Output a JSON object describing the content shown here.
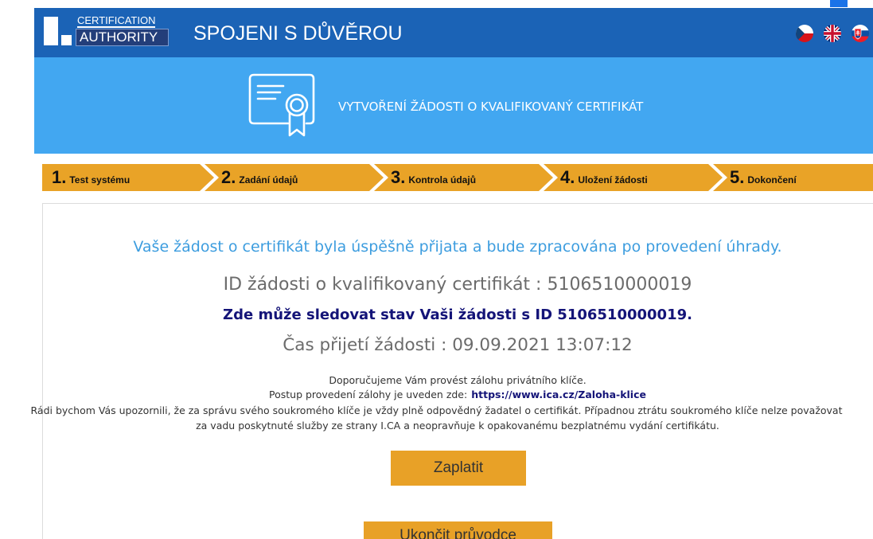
{
  "colors": {
    "header_bg": "#1b63b6",
    "banner_bg": "#42a7f1",
    "steps_bg": "#e9a327",
    "success_text": "#3d9ddf",
    "muted_text": "#666666",
    "link_text": "#141478",
    "button_bg": "#e8a127"
  },
  "header": {
    "logo": {
      "mark": "I.",
      "line1": "CERTIFICATION",
      "line2": "AUTHORITY"
    },
    "tagline": "SPOJENI S DŮVĚROU",
    "languages": [
      {
        "icon": "flag-cz-icon"
      },
      {
        "icon": "flag-gb-icon"
      },
      {
        "icon": "flag-sk-icon"
      }
    ]
  },
  "banner": {
    "icon": "certificate-icon",
    "title": "VYTVOŘENÍ ŽÁDOSTI O KVALIFIKOVANÝ CERTIFIKÁT"
  },
  "steps": [
    {
      "number": "1.",
      "label": "Test systému"
    },
    {
      "number": "2.",
      "label": "Zadání údajů"
    },
    {
      "number": "3.",
      "label": "Kontrola údajů"
    },
    {
      "number": "4.",
      "label": "Uložení žádosti"
    },
    {
      "number": "5.",
      "label": "Dokončení"
    }
  ],
  "result": {
    "success_message": "Vaše žádost o certifikát byla úspěšně přijata a bude zpracována po provedení úhrady.",
    "request_id_line": "ID žádosti o kvalifikovaný certifikát : 5106510000019",
    "tracking_link": "Zde může sledovat stav Vaši žádosti s ID 5106510000019.",
    "received_time_line": "Čas přijetí žádosti : 09.09.2021 13:07:12"
  },
  "backup": {
    "recommendation": "Doporučujeme Vám provést zálohu privátního klíče.",
    "instructions_prefix": "Postup provedení zálohy je uveden zde:",
    "instructions_link": "https://www.ica.cz/Zaloha-klice",
    "notice_lines": [
      "Rádi bychom Vás upozornili, že za správu svého soukromého klíče je vždy plně odpovědný žadatel o certifikát. Případnou ztrátu soukromého klíče nelze považovat",
      "za vadu poskytnuté služby ze strany I.CA a neopravňuje k opakovanému bezplatnému vydání certifikátu."
    ]
  },
  "actions": {
    "pay_label": "Zaplatit",
    "exit_label": "Ukončit průvodce"
  }
}
